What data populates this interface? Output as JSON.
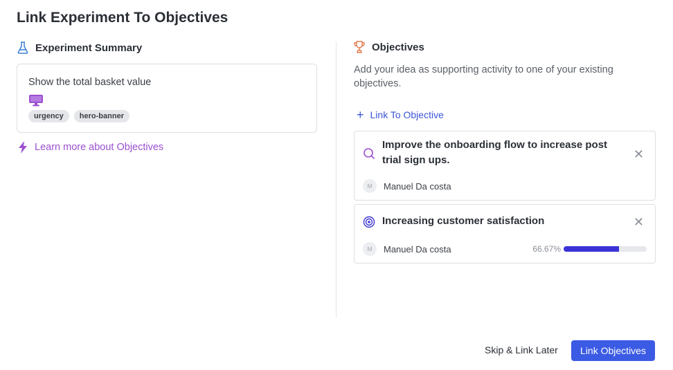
{
  "modal": {
    "title": "Link Experiment To Objectives"
  },
  "summary": {
    "heading": "Experiment Summary",
    "text": "Show the total basket value",
    "device_icon": "desktop-icon",
    "tags": [
      "urgency",
      "hero-banner"
    ],
    "learn_more": "Learn more about Objectives"
  },
  "objectives": {
    "heading": "Objectives",
    "description": "Add your idea as supporting activity to one of your existing objectives.",
    "link_label": "Link To Objective",
    "items": [
      {
        "title": "Improve the onboarding flow to increase post trial sign ups.",
        "icon": "search-icon",
        "owner_initial": "M",
        "owner": "Manuel Da costa"
      },
      {
        "title": "Increasing customer satisfaction",
        "icon": "target-icon",
        "owner_initial": "M",
        "owner": "Manuel Da costa",
        "progress_label": "66.67%",
        "progress": 0.6667
      }
    ]
  },
  "footer": {
    "skip_label": "Skip & Link Later",
    "primary_label": "Link Objectives"
  },
  "colors": {
    "accent": "#3b5be4",
    "learn_link": "#9b4fcf",
    "progress": "#3b33d6",
    "trophy": "#e0794a"
  }
}
